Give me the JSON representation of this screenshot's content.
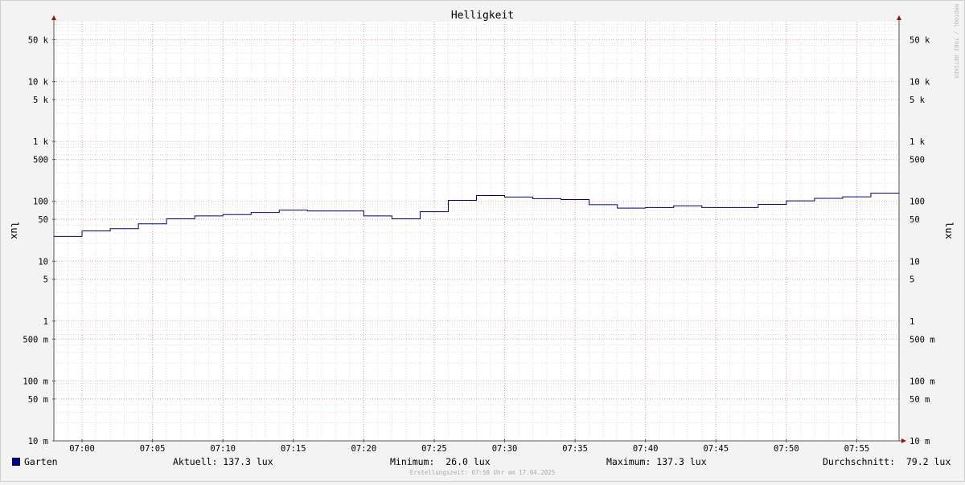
{
  "chart_data": {
    "type": "line",
    "title": "Helligkeit",
    "ylabel": "lux",
    "ylabel_right": "lux",
    "y_scale": "log",
    "ylim": [
      0.01,
      100000
    ],
    "y_ticks": [
      {
        "v": 50000,
        "label": "50 k"
      },
      {
        "v": 10000,
        "label": "10 k"
      },
      {
        "v": 5000,
        "label": "5 k"
      },
      {
        "v": 1000,
        "label": "1 k"
      },
      {
        "v": 500,
        "label": "500"
      },
      {
        "v": 100,
        "label": "100"
      },
      {
        "v": 50,
        "label": "50"
      },
      {
        "v": 10,
        "label": "10"
      },
      {
        "v": 5,
        "label": "5"
      },
      {
        "v": 1,
        "label": "1"
      },
      {
        "v": 0.5,
        "label": "500 m"
      },
      {
        "v": 0.1,
        "label": "100 m"
      },
      {
        "v": 0.05,
        "label": "50 m"
      },
      {
        "v": 0.01,
        "label": "10 m"
      }
    ],
    "x_ticks": [
      "07:00",
      "07:05",
      "07:10",
      "07:15",
      "07:20",
      "07:25",
      "07:30",
      "07:35",
      "07:40",
      "07:45",
      "07:50",
      "07:55"
    ],
    "x_range": [
      "06:58",
      "07:58"
    ],
    "grid": true,
    "series": [
      {
        "name": "Garten",
        "color": "#000080",
        "step": true,
        "x": [
          "06:58",
          "07:00",
          "07:02",
          "07:04",
          "07:06",
          "07:08",
          "07:10",
          "07:12",
          "07:14",
          "07:16",
          "07:18",
          "07:20",
          "07:22",
          "07:24",
          "07:26",
          "07:28",
          "07:30",
          "07:32",
          "07:34",
          "07:36",
          "07:38",
          "07:40",
          "07:42",
          "07:44",
          "07:46",
          "07:48",
          "07:50",
          "07:52",
          "07:54",
          "07:56"
        ],
        "values": [
          26,
          32,
          35,
          42,
          51,
          57,
          60,
          65,
          71,
          69,
          69,
          57,
          51,
          67,
          104,
          125,
          118,
          111,
          107,
          88,
          77,
          79,
          84,
          79,
          79,
          89,
          102,
          112,
          119,
          137.3
        ]
      }
    ]
  },
  "legend": {
    "series_name": "Garten",
    "current": "Aktuell: 137.3 lux",
    "minimum": "Minimum:  26.0 lux",
    "maximum": "Maximum: 137.3 lux",
    "average": "Durchschnitt:  79.2 lux"
  },
  "footer": "Erstellungszeit: 07:58 Uhr am 17.04.2025",
  "watermark": "RRDTOOL / TOBI OETIKER"
}
